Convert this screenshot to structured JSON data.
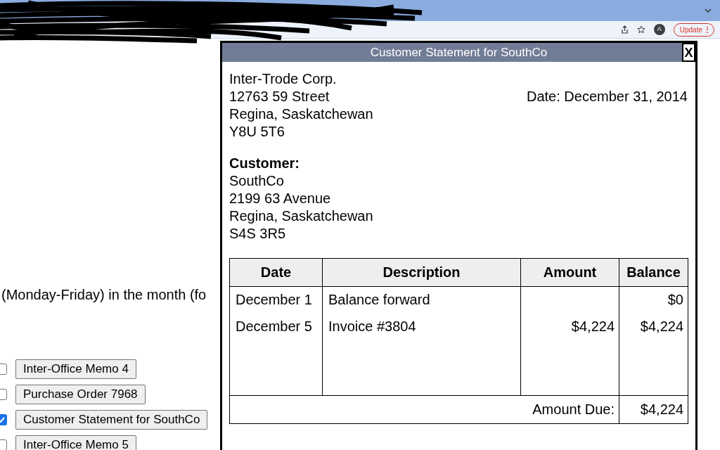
{
  "browser": {
    "avatar": "A",
    "update_button": "Update"
  },
  "page": {
    "text": "(Monday-Friday) in the month (fo",
    "documents": [
      {
        "label": "Inter-Office Memo 4",
        "checked": false
      },
      {
        "label": "Purchase Order 7968",
        "checked": false
      },
      {
        "label": "Customer Statement for SouthCo",
        "checked": true
      },
      {
        "label": "Inter-Office Memo 5",
        "checked": false
      }
    ]
  },
  "statement": {
    "title": "Customer Statement for SouthCo",
    "close": "X",
    "sender": [
      "Inter-Trode Corp.",
      "12763 59 Street",
      "Regina, Saskatchewan",
      "Y8U 5T6"
    ],
    "date": "Date: December 31, 2014",
    "customer_label": "Customer:",
    "customer": [
      "SouthCo",
      "2199 63 Avenue",
      "Regina, Saskatchewan",
      "S4S 3R5"
    ],
    "table": {
      "columns": [
        "Date",
        "Description",
        "Amount",
        "Balance"
      ],
      "rows": [
        {
          "date": "December 1",
          "description": "Balance forward",
          "amount": "",
          "balance": "$0"
        },
        {
          "date": "December 5",
          "description": "Invoice #3804",
          "amount": "$4,224",
          "balance": "$4,224"
        }
      ],
      "footer": {
        "label": "Amount Due:",
        "value": "$4,224"
      }
    }
  }
}
